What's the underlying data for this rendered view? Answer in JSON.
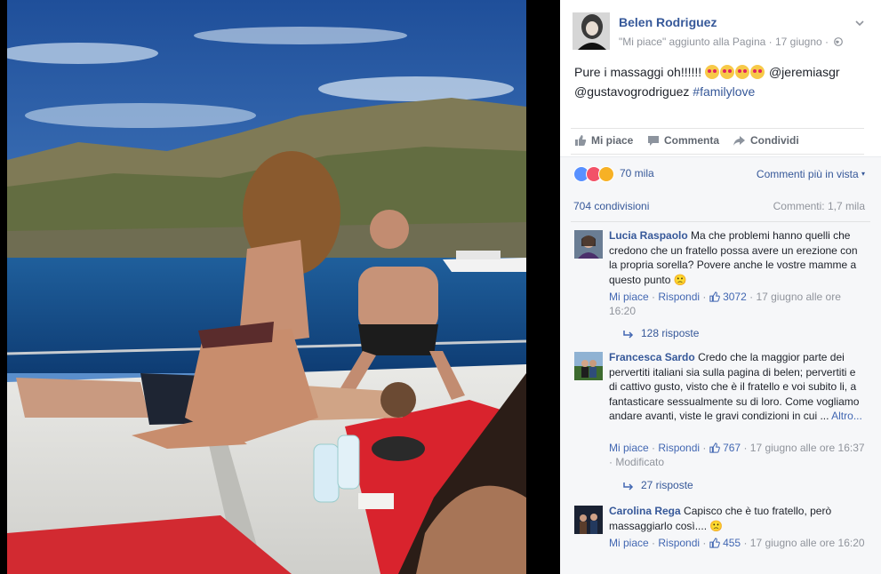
{
  "post": {
    "page_name": "Belen Rodriguez",
    "meta_text": "\"Mi piace\" aggiunto alla Pagina · 17 giugno ·",
    "caption_text": "Pure i massaggi oh!!!!!!",
    "caption_mentions": "@jeremiasgr",
    "caption_line2": "@gustavogrodriguez",
    "caption_hashtag": "#familylove"
  },
  "actions": {
    "like": "Mi piace",
    "comment": "Commenta",
    "share": "Condividi"
  },
  "stats": {
    "reactions": "70 mila",
    "sort": "Commenti più in vista",
    "shares": "704 condivisioni",
    "comments": "Commenti: 1,7 mila"
  },
  "comments": [
    {
      "author": "Lucia Raspaolo",
      "text": "Ma che problemi hanno quelli che credono che un fratello possa avere un erezione con la propria sorella? Povere anche le vostre mamme a questo punto 🙁",
      "like_label": "Mi piace",
      "reply_label": "Rispondi",
      "likes": "3072",
      "time": "17 giugno alle ore 16:20",
      "replies": "128 risposte"
    },
    {
      "author": "Francesca Sardo",
      "text": "Credo che la maggior parte dei pervertiti italiani sia sulla pagina di belen; pervertiti e di cattivo gusto, visto che è il fratello e voi subito li, a fantasticare sessualmente su di loro. Come vogliamo andare avanti, viste le gravi condizioni in cui ...",
      "more": "Altro...",
      "like_label": "Mi piace",
      "reply_label": "Rispondi",
      "likes": "767",
      "time": "17 giugno alle ore 16:37 · Modificato",
      "replies": "27 risposte"
    },
    {
      "author": "Carolina Rega",
      "text": "Capisco che è tuo fratello, però massaggiarlo così.... 🙁",
      "like_label": "Mi piace",
      "reply_label": "Rispondi",
      "likes": "455",
      "time": "17 giugno alle ore 16:20"
    }
  ],
  "colors": {
    "link": "#365899",
    "muted": "#90949c",
    "panel_bg": "#f6f7f9"
  }
}
